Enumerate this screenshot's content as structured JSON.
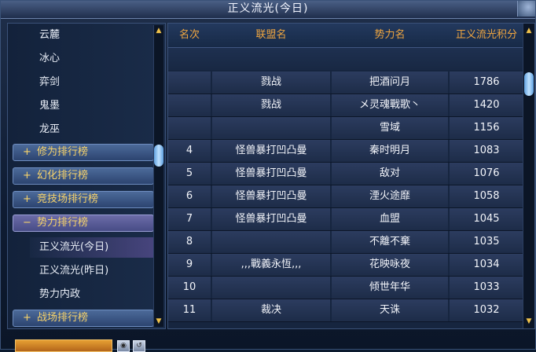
{
  "window": {
    "title": "正义流光(今日)"
  },
  "sidebar": {
    "items_top": [
      "云麓",
      "冰心",
      "弈剑",
      "鬼墨",
      "龙巫"
    ],
    "categories_collapsed": [
      {
        "sign": "+",
        "label": "修为排行榜"
      },
      {
        "sign": "+",
        "label": "幻化排行榜"
      },
      {
        "sign": "+",
        "label": "竞技场排行榜"
      }
    ],
    "category_open": {
      "sign": "−",
      "label": "势力排行榜"
    },
    "sub_items": [
      "正义流光(今日)",
      "正义流光(昨日)",
      "势力内政"
    ],
    "selected_sub_item": "正义流光(今日)",
    "category_last": {
      "sign": "+",
      "label": "战场排行榜"
    }
  },
  "table": {
    "headers": {
      "rank": "名次",
      "alliance": "联盟名",
      "faction": "势力名",
      "points": "正义流光积分"
    },
    "rows": [
      {
        "rank": "",
        "rank_icon": "gold-leopard-icon",
        "alliance": "戮战",
        "faction": "把酒问月",
        "points": "1786"
      },
      {
        "rank": "",
        "rank_icon": "silver-leopard-icon",
        "alliance": "戮战",
        "faction": "メ灵魂戰歌丶",
        "points": "1420"
      },
      {
        "rank": "",
        "rank_icon": "bronze-leopard-icon",
        "alliance": "",
        "faction": "雪域",
        "points": "1156"
      },
      {
        "rank": "4",
        "alliance": "怪兽暴打凹凸曼",
        "faction": "秦时明月",
        "points": "1083"
      },
      {
        "rank": "5",
        "alliance": "怪兽暴打凹凸曼",
        "faction": "敌对",
        "points": "1076"
      },
      {
        "rank": "6",
        "alliance": "怪兽暴打凹凸曼",
        "faction": "湮火途靡",
        "points": "1058"
      },
      {
        "rank": "7",
        "alliance": "怪兽暴打凹凸曼",
        "faction": "血盟",
        "points": "1045"
      },
      {
        "rank": "8",
        "alliance": "",
        "faction": "不離不棄",
        "points": "1035"
      },
      {
        "rank": "9",
        "alliance": ",,,戰義永恆,,,",
        "faction": "花映咏夜",
        "points": "1034"
      },
      {
        "rank": "10",
        "alliance": "",
        "faction": "倾世年华",
        "points": "1033"
      },
      {
        "rank": "11",
        "alliance": "裁决",
        "faction": "天诛",
        "points": "1032"
      }
    ]
  },
  "colors": {
    "header_text": "#f0a640",
    "category_text": "#f7d36b",
    "gold": "#e3a63a",
    "silver": "#c8ced8",
    "bronze": "#c8895a"
  },
  "bottom": {
    "buttons": [
      "lock-icon",
      "refresh-icon"
    ]
  }
}
